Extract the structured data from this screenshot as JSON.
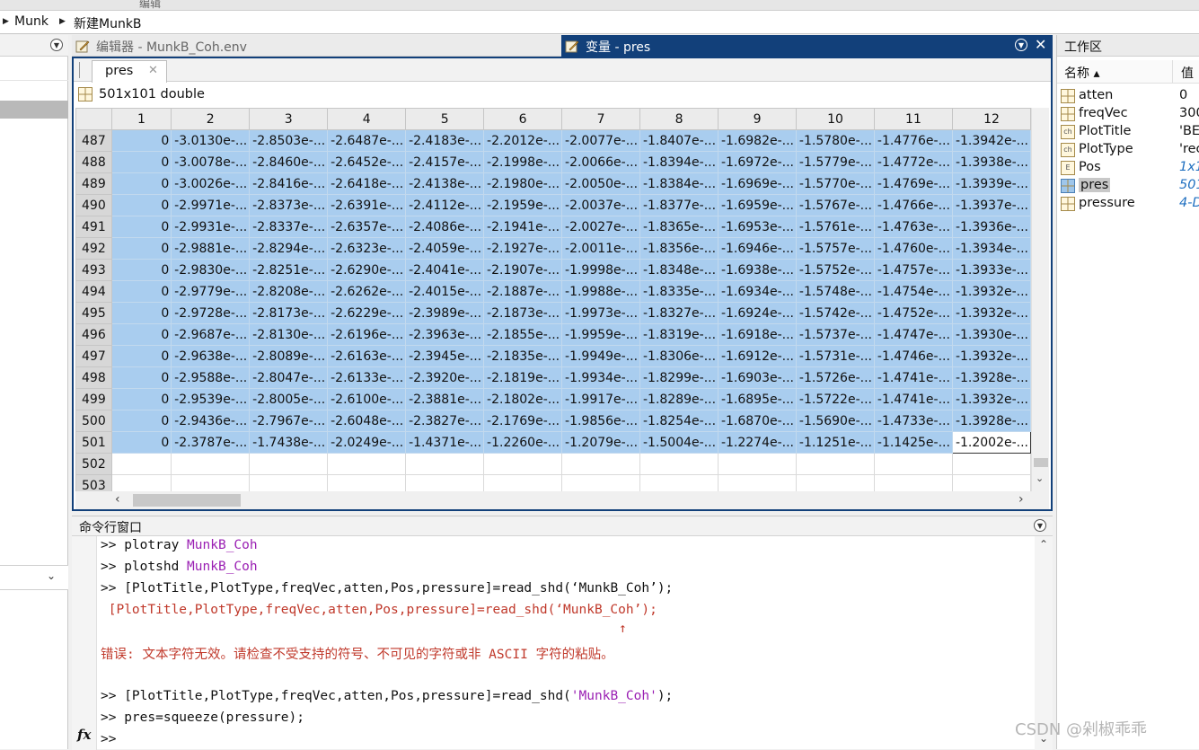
{
  "top_strip_label": "编辑",
  "breadcrumb": [
    "Munk",
    "新建MunkB"
  ],
  "tabs": {
    "editor_label": "编辑器 - MunkB_Coh.env",
    "variable_label": "变量 - pres"
  },
  "variable": {
    "subtab": "pres",
    "info": "501x101 double",
    "columns": [
      "1",
      "2",
      "3",
      "4",
      "5",
      "6",
      "7",
      "8",
      "9",
      "10",
      "11",
      "12"
    ],
    "rows": [
      {
        "idx": "487",
        "cells": [
          "0",
          "-3.0130e-...",
          "-2.8503e-...",
          "-2.6487e-...",
          "-2.4183e-...",
          "-2.2012e-...",
          "-2.0077e-...",
          "-1.8407e-...",
          "-1.6982e-...",
          "-1.5780e-...",
          "-1.4776e-...",
          "-1.3942e-..."
        ]
      },
      {
        "idx": "488",
        "cells": [
          "0",
          "-3.0078e-...",
          "-2.8460e-...",
          "-2.6452e-...",
          "-2.4157e-...",
          "-2.1998e-...",
          "-2.0066e-...",
          "-1.8394e-...",
          "-1.6972e-...",
          "-1.5779e-...",
          "-1.4772e-...",
          "-1.3938e-..."
        ]
      },
      {
        "idx": "489",
        "cells": [
          "0",
          "-3.0026e-...",
          "-2.8416e-...",
          "-2.6418e-...",
          "-2.4138e-...",
          "-2.1980e-...",
          "-2.0050e-...",
          "-1.8384e-...",
          "-1.6969e-...",
          "-1.5770e-...",
          "-1.4769e-...",
          "-1.3939e-..."
        ]
      },
      {
        "idx": "490",
        "cells": [
          "0",
          "-2.9971e-...",
          "-2.8373e-...",
          "-2.6391e-...",
          "-2.4112e-...",
          "-2.1959e-...",
          "-2.0037e-...",
          "-1.8377e-...",
          "-1.6959e-...",
          "-1.5767e-...",
          "-1.4766e-...",
          "-1.3937e-..."
        ]
      },
      {
        "idx": "491",
        "cells": [
          "0",
          "-2.9931e-...",
          "-2.8337e-...",
          "-2.6357e-...",
          "-2.4086e-...",
          "-2.1941e-...",
          "-2.0027e-...",
          "-1.8365e-...",
          "-1.6953e-...",
          "-1.5761e-...",
          "-1.4763e-...",
          "-1.3936e-..."
        ]
      },
      {
        "idx": "492",
        "cells": [
          "0",
          "-2.9881e-...",
          "-2.8294e-...",
          "-2.6323e-...",
          "-2.4059e-...",
          "-2.1927e-...",
          "-2.0011e-...",
          "-1.8356e-...",
          "-1.6946e-...",
          "-1.5757e-...",
          "-1.4760e-...",
          "-1.3934e-..."
        ]
      },
      {
        "idx": "493",
        "cells": [
          "0",
          "-2.9830e-...",
          "-2.8251e-...",
          "-2.6290e-...",
          "-2.4041e-...",
          "-2.1907e-...",
          "-1.9998e-...",
          "-1.8348e-...",
          "-1.6938e-...",
          "-1.5752e-...",
          "-1.4757e-...",
          "-1.3933e-..."
        ]
      },
      {
        "idx": "494",
        "cells": [
          "0",
          "-2.9779e-...",
          "-2.8208e-...",
          "-2.6262e-...",
          "-2.4015e-...",
          "-2.1887e-...",
          "-1.9988e-...",
          "-1.8335e-...",
          "-1.6934e-...",
          "-1.5748e-...",
          "-1.4754e-...",
          "-1.3932e-..."
        ]
      },
      {
        "idx": "495",
        "cells": [
          "0",
          "-2.9728e-...",
          "-2.8173e-...",
          "-2.6229e-...",
          "-2.3989e-...",
          "-2.1873e-...",
          "-1.9973e-...",
          "-1.8327e-...",
          "-1.6924e-...",
          "-1.5742e-...",
          "-1.4752e-...",
          "-1.3932e-..."
        ]
      },
      {
        "idx": "496",
        "cells": [
          "0",
          "-2.9687e-...",
          "-2.8130e-...",
          "-2.6196e-...",
          "-2.3963e-...",
          "-2.1855e-...",
          "-1.9959e-...",
          "-1.8319e-...",
          "-1.6918e-...",
          "-1.5737e-...",
          "-1.4747e-...",
          "-1.3930e-..."
        ]
      },
      {
        "idx": "497",
        "cells": [
          "0",
          "-2.9638e-...",
          "-2.8089e-...",
          "-2.6163e-...",
          "-2.3945e-...",
          "-2.1835e-...",
          "-1.9949e-...",
          "-1.8306e-...",
          "-1.6912e-...",
          "-1.5731e-...",
          "-1.4746e-...",
          "-1.3932e-..."
        ]
      },
      {
        "idx": "498",
        "cells": [
          "0",
          "-2.9588e-...",
          "-2.8047e-...",
          "-2.6133e-...",
          "-2.3920e-...",
          "-2.1819e-...",
          "-1.9934e-...",
          "-1.8299e-...",
          "-1.6903e-...",
          "-1.5726e-...",
          "-1.4741e-...",
          "-1.3928e-..."
        ]
      },
      {
        "idx": "499",
        "cells": [
          "0",
          "-2.9539e-...",
          "-2.8005e-...",
          "-2.6100e-...",
          "-2.3881e-...",
          "-2.1802e-...",
          "-1.9917e-...",
          "-1.8289e-...",
          "-1.6895e-...",
          "-1.5722e-...",
          "-1.4741e-...",
          "-1.3932e-..."
        ]
      },
      {
        "idx": "500",
        "cells": [
          "0",
          "-2.9436e-...",
          "-2.7967e-...",
          "-2.6048e-...",
          "-2.3827e-...",
          "-2.1769e-...",
          "-1.9856e-...",
          "-1.8254e-...",
          "-1.6870e-...",
          "-1.5690e-...",
          "-1.4733e-...",
          "-1.3928e-..."
        ]
      },
      {
        "idx": "501",
        "cells": [
          "0",
          "-2.3787e-...",
          "-1.7438e-...",
          "-2.0249e-...",
          "-1.4371e-...",
          "-1.2260e-...",
          "-1.2079e-...",
          "-1.5004e-...",
          "-1.2274e-...",
          "-1.1251e-...",
          "-1.1425e-...",
          "-1.2002e-..."
        ]
      },
      {
        "idx": "502",
        "cells": []
      },
      {
        "idx": "503",
        "cells": []
      }
    ]
  },
  "command_window": {
    "title": "命令行窗口",
    "lines": [
      {
        "prompt": ">> ",
        "text": "plotray ",
        "arg": "MunkB_Coh",
        "rest": ""
      },
      {
        "prompt": ">> ",
        "text": "plotshd ",
        "arg": "MunkB_Coh",
        "rest": ""
      },
      {
        "prompt": ">> ",
        "text": "[PlotTitle,PlotType,freqVec,atten,Pos,pressure]=read_shd(‘MunkB_Coh’);",
        "arg": "",
        "rest": ""
      }
    ],
    "error_echo": " [PlotTitle,PlotType,freqVec,atten,Pos,pressure]=read_shd(‘MunkB_Coh’);",
    "error_caret": "↑",
    "error_message": "错误: 文本字符无效。请检查不受支持的符号、不可见的字符或非 ASCII 字符的粘贴。",
    "line4_prefix": ">> [PlotTitle,PlotType,freqVec,atten,Pos,pressure]=read_shd(",
    "line4_arg": "'MunkB_Coh'",
    "line4_suffix": ");",
    "line5": ">> pres=squeeze(pressure);",
    "fx_label": "fx",
    "prompt": ">>"
  },
  "workspace": {
    "title": "工作区",
    "col_name": "名称 ▴",
    "col_value": "值",
    "vars": [
      {
        "name": "atten",
        "value": "0",
        "icon": "matrix-icon"
      },
      {
        "name": "freqVec",
        "value": "300",
        "icon": "matrix-icon"
      },
      {
        "name": "PlotTitle",
        "value": "'BE",
        "icon": "char-icon"
      },
      {
        "name": "PlotType",
        "value": "'rec",
        "icon": "char-icon"
      },
      {
        "name": "Pos",
        "value": "1x1",
        "icon": "struct-icon"
      },
      {
        "name": "pres",
        "value": "501",
        "icon": "matrix-icon"
      },
      {
        "name": "pressure",
        "value": "4-D",
        "icon": "matrix-icon"
      }
    ]
  },
  "watermark": "CSDN @剁椒乖乖",
  "colors": {
    "accent": "#12407a",
    "selection": "#a9cdef",
    "purple": "#9a1fb3",
    "error": "#c0392b"
  }
}
